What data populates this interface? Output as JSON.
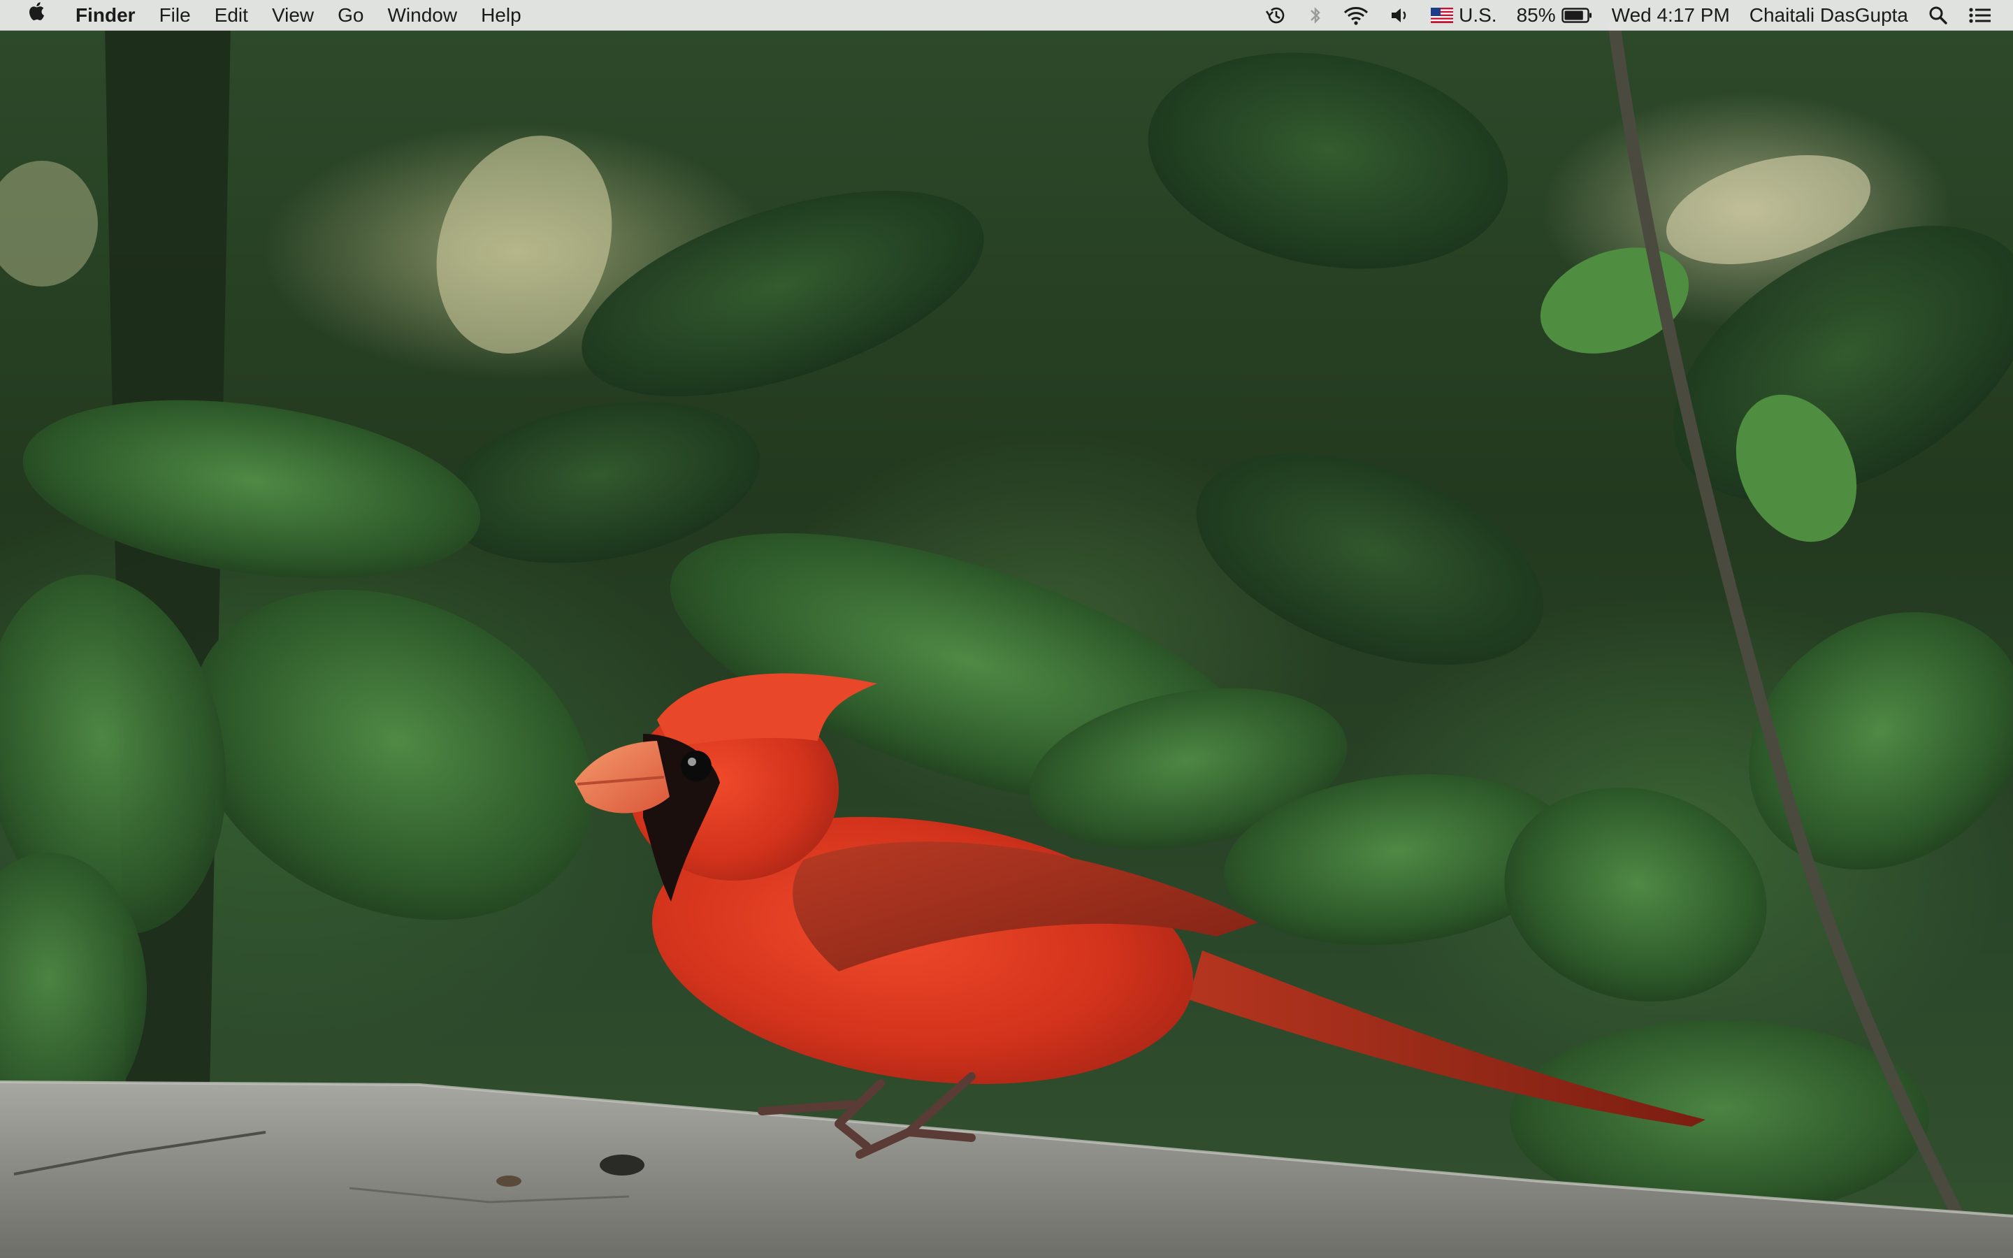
{
  "menubar": {
    "app_menu": [
      {
        "label": "Finder"
      },
      {
        "label": "File"
      },
      {
        "label": "Edit"
      },
      {
        "label": "View"
      },
      {
        "label": "Go"
      },
      {
        "label": "Window"
      },
      {
        "label": "Help"
      }
    ],
    "status": {
      "input_source": "U.S.",
      "battery_percent": "85%",
      "battery_level": 0.85,
      "clock": "Wed 4:17 PM",
      "user": "Chaitali DasGupta"
    },
    "icons": [
      "apple-icon",
      "time-machine-icon",
      "bluetooth-icon",
      "wifi-icon",
      "volume-icon",
      "us-flag-icon",
      "battery-icon",
      "spotlight-search-icon",
      "notification-center-icon"
    ]
  },
  "colors": {
    "menubar_bg": "#ececec",
    "cardinal_red": "#d8321e",
    "foliage_green": "#2f5a2c",
    "perch_gray": "#8f8f8a"
  }
}
